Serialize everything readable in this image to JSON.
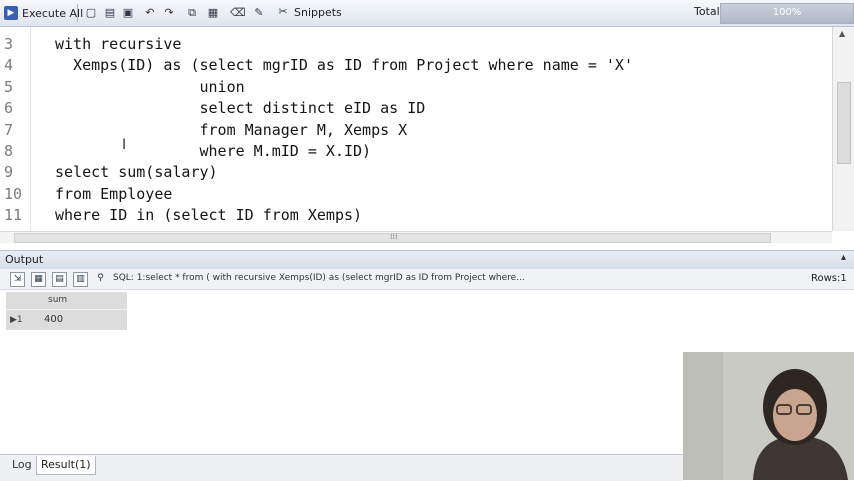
{
  "toolbar": {
    "execute_all_label": "Execute All",
    "snippets_label": "Snippets",
    "total_label": "Total",
    "progress_text": "100%",
    "progress_fraction": 1.0
  },
  "editor": {
    "lines": [
      {
        "num": "3",
        "text": "with recursive"
      },
      {
        "num": "4",
        "text": "  Xemps(ID) as (select mgrID as ID from Project where name = 'X'"
      },
      {
        "num": "5",
        "text": "                union"
      },
      {
        "num": "6",
        "text": "                select distinct eID as ID"
      },
      {
        "num": "7",
        "text": "                from Manager M, Xemps X"
      },
      {
        "num": "8",
        "text": "                where M.mID = X.ID)"
      },
      {
        "num": "9",
        "text": "select sum(salary)"
      },
      {
        "num": "10",
        "text": "from Employee"
      },
      {
        "num": "11",
        "text": "where ID in (select ID from Xemps)"
      }
    ],
    "caret_glyph": "I"
  },
  "output": {
    "title": "Output",
    "sql_summary": "SQL: 1:select * from (    with recursive    Xemps(ID) as (select mgrID as ID from Project where...",
    "rows_label": "Rows:1",
    "grid": {
      "column": "sum",
      "rows": [
        {
          "row_num": "▶1",
          "value": "400"
        }
      ]
    }
  },
  "tabs": {
    "log": "Log",
    "result": "Result(1)"
  },
  "colors": {
    "toolbar_bg": "#dfe5ee",
    "grid_bg": "#dcdcdc",
    "code_text": "#151515",
    "line_number": "#7c7c7c"
  }
}
